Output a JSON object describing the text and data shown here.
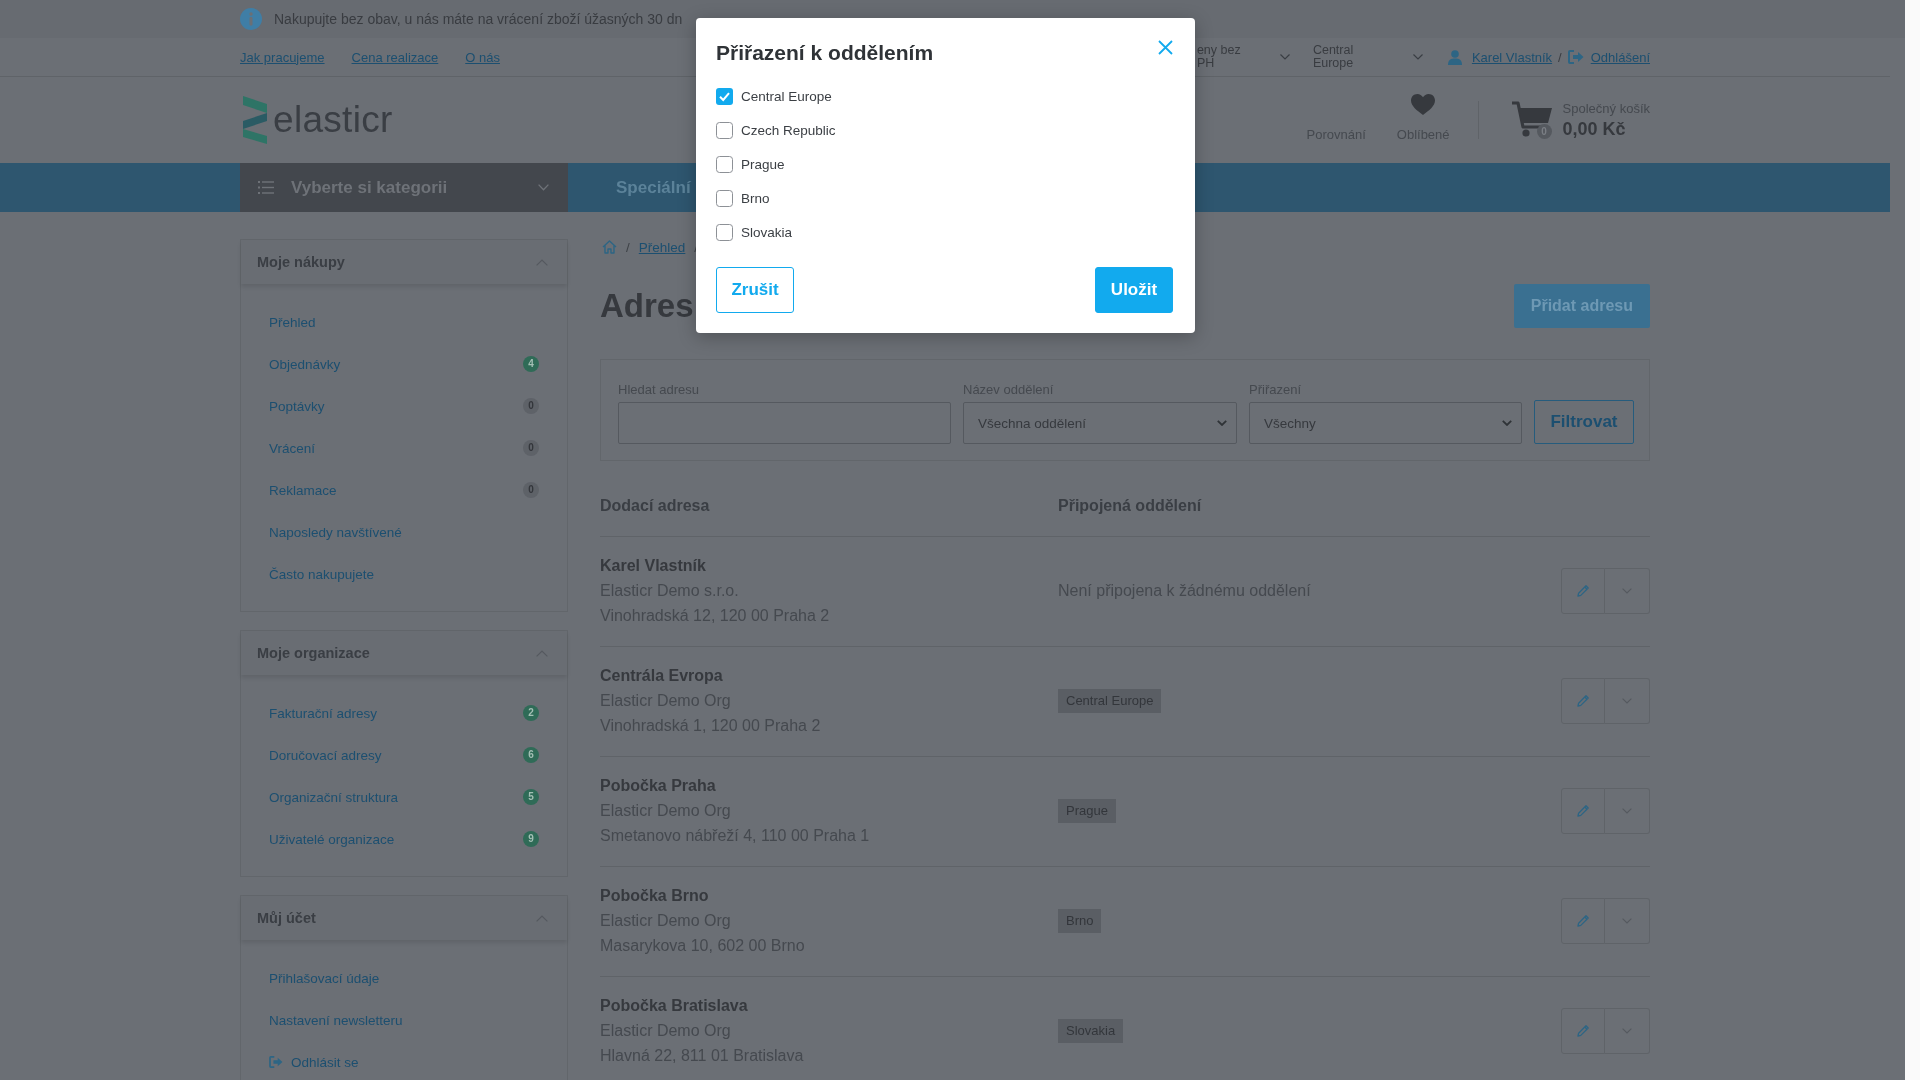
{
  "info_bar": {
    "text": "Nakupujte bez obav, u nás máte na vrácení zboží úžasných 30 dn"
  },
  "top_links": [
    "Jak pracujeme",
    "Cena realizace",
    "O nás"
  ],
  "selectors": [
    {
      "value": "eny bez PH"
    },
    {
      "value": "Central Europe"
    }
  ],
  "user": {
    "name": "Karel Vlastník",
    "separator": "/",
    "logout": "Odhlášení"
  },
  "logo": {
    "text": "elasticr"
  },
  "header_links": [
    {
      "label": "Porovnání",
      "kind": "compare"
    },
    {
      "label": "Oblíbené",
      "kind": "favorites"
    }
  ],
  "cart": {
    "label": "Společný košík",
    "total": "0,00 Kč",
    "count": "0"
  },
  "nav": {
    "category_button": "Vyberte si kategorii",
    "items": [
      "Speciální"
    ]
  },
  "sidebar": {
    "sections": [
      {
        "title": "Moje nákupy",
        "expanded": true,
        "items": [
          {
            "label": "Přehled",
            "kind": "link"
          },
          {
            "label": "Objednávky",
            "kind": "link",
            "badge": {
              "text": "4",
              "kind": "success"
            }
          },
          {
            "label": "Poptávky",
            "kind": "link",
            "badge": {
              "text": "0",
              "kind": "muted"
            }
          },
          {
            "label": "Vrácení",
            "kind": "link",
            "badge": {
              "text": "0",
              "kind": "muted"
            }
          },
          {
            "label": "Reklamace",
            "kind": "link",
            "badge": {
              "text": "0",
              "kind": "muted"
            }
          },
          {
            "label": "Naposledy navštívené",
            "kind": "link"
          },
          {
            "label": "Často nakupujete",
            "kind": "link"
          }
        ]
      },
      {
        "title": "Moje organizace",
        "expanded": true,
        "items": [
          {
            "label": "Fakturační adresy",
            "kind": "link",
            "badge": {
              "text": "2",
              "kind": "success"
            }
          },
          {
            "label": "Doručovací adresy",
            "kind": "link",
            "badge": {
              "text": "6",
              "kind": "success"
            }
          },
          {
            "label": "Organizační struktura",
            "kind": "link",
            "badge": {
              "text": "5",
              "kind": "success"
            }
          },
          {
            "label": "Uživatelé organizace",
            "kind": "link",
            "badge": {
              "text": "9",
              "kind": "success"
            }
          }
        ]
      },
      {
        "title": "Můj účet",
        "expanded": true,
        "items": [
          {
            "label": "Přihlašovací údaje",
            "kind": "link"
          },
          {
            "label": "Nastavení newsletteru",
            "kind": "link"
          },
          {
            "label": "Odhlásit se",
            "kind": "logout"
          }
        ]
      }
    ]
  },
  "breadcrumb": {
    "separator": "/",
    "items": [
      "Přehled"
    ]
  },
  "page": {
    "title": "Adres",
    "add_button": "Přidat adresu"
  },
  "filters": {
    "fields": [
      {
        "label": "Hledat adresu",
        "kind": "text"
      },
      {
        "label": "Název oddělení",
        "kind": "select",
        "value": "Všechna oddělení"
      },
      {
        "label": "Přiřazení",
        "kind": "select",
        "value": "Všechny"
      }
    ],
    "button": "Filtrovat"
  },
  "table": {
    "columns": [
      "Dodací adresa",
      "Připojená oddělení"
    ],
    "rows": [
      {
        "name": "Karel Vlastník",
        "company": "Elasticr Demo s.r.o.",
        "address": "Vinohradská 12, 120 00 Praha 2",
        "departments_note": "Není připojena k žádnému oddělení"
      },
      {
        "name": "Centrála Evropa",
        "company": "Elasticr Demo Org",
        "address": "Vinohradská 1, 120 00 Praha 2",
        "departments": [
          "Central Europe"
        ]
      },
      {
        "name": "Pobočka Praha",
        "company": "Elasticr Demo Org",
        "address": "Smetanovo nábřeží 4, 110 00 Praha 1",
        "departments": [
          "Prague"
        ]
      },
      {
        "name": "Pobočka Brno",
        "company": "Elasticr Demo Org",
        "address": "Masarykova 10, 602 00 Brno",
        "departments": [
          "Brno"
        ]
      },
      {
        "name": "Pobočka Bratislava",
        "company": "Elasticr Demo Org",
        "address": "Hlavná 22, 811 01 Bratislava",
        "departments": [
          "Slovakia"
        ]
      }
    ]
  },
  "modal": {
    "title": "Přiřazení k oddělením",
    "options": [
      {
        "label": "Central Europe",
        "checked": true
      },
      {
        "label": "Czech Republic",
        "checked": false
      },
      {
        "label": "Prague",
        "checked": false
      },
      {
        "label": "Brno",
        "checked": false
      },
      {
        "label": "Slovakia",
        "checked": false
      }
    ],
    "buttons": [
      {
        "label": "Zrušit",
        "kind": "secondary"
      },
      {
        "label": "Uložit",
        "kind": "primary"
      }
    ]
  }
}
